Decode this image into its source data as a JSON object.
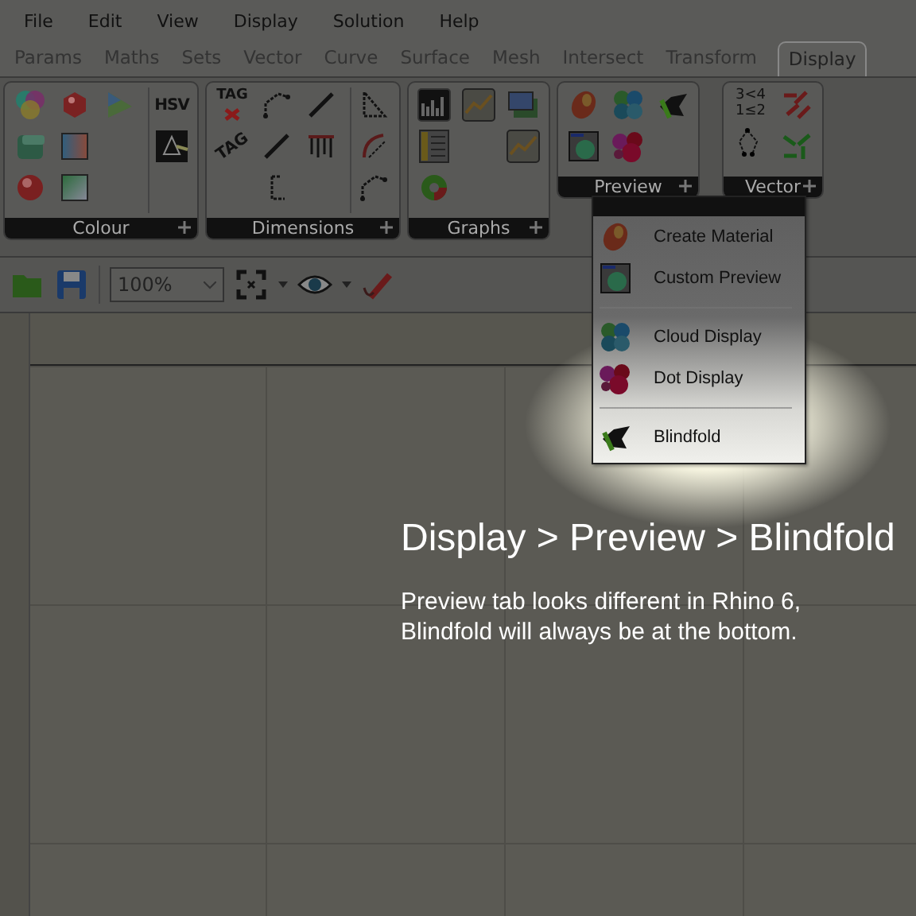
{
  "menu": [
    "File",
    "Edit",
    "View",
    "Display",
    "Solution",
    "Help"
  ],
  "tabs": [
    {
      "label": "Params",
      "selected": false
    },
    {
      "label": "Maths",
      "selected": false
    },
    {
      "label": "Sets",
      "selected": false
    },
    {
      "label": "Vector",
      "selected": false
    },
    {
      "label": "Curve",
      "selected": false
    },
    {
      "label": "Surface",
      "selected": false
    },
    {
      "label": "Mesh",
      "selected": false
    },
    {
      "label": "Intersect",
      "selected": false
    },
    {
      "label": "Transform",
      "selected": false
    },
    {
      "label": "Display",
      "selected": true
    }
  ],
  "ribbon": [
    {
      "name": "Colour",
      "columns": [
        [
          {
            "kind": "color-wheel"
          },
          {
            "kind": "cube"
          },
          {
            "kind": "sphere"
          }
        ],
        [
          {
            "kind": "gem"
          },
          {
            "kind": "gradient-square"
          },
          {
            "kind": "diagonal-gradient-square"
          }
        ],
        [
          {
            "kind": "color-triangle"
          }
        ],
        [
          {
            "kind": "text",
            "label": "HSV"
          },
          {
            "kind": "prism"
          }
        ]
      ]
    },
    {
      "name": "Dimensions",
      "columns": [
        [
          {
            "kind": "tag-delete",
            "label": "TAG"
          },
          {
            "kind": "tag",
            "label": "TAG"
          }
        ],
        [
          {
            "kind": "angle-dimension"
          },
          {
            "kind": "line-dimension"
          },
          {
            "kind": "elevation-dimension"
          }
        ],
        [
          {
            "kind": "line-dimension"
          },
          {
            "kind": "ticks"
          }
        ],
        [
          {
            "kind": "triangle-dimension"
          },
          {
            "kind": "arc-dimension"
          },
          {
            "kind": "angle-dimension"
          }
        ]
      ]
    },
    {
      "name": "Graphs",
      "columns": [
        [
          {
            "kind": "histogram"
          },
          {
            "kind": "legend"
          },
          {
            "kind": "pie-gauge"
          }
        ],
        [
          {
            "kind": "line-graph"
          }
        ],
        [
          {
            "kind": "image"
          },
          {
            "kind": "line-graph"
          }
        ]
      ]
    },
    {
      "name": "Preview",
      "columns": [
        [
          {
            "kind": "egg"
          },
          {
            "kind": "custom-preview"
          }
        ],
        [
          {
            "kind": "cloud"
          },
          {
            "kind": "dots"
          }
        ],
        [
          {
            "kind": "blindfold"
          }
        ]
      ]
    },
    {
      "name": "Vector",
      "columns": [
        [
          {
            "kind": "numbers",
            "label": "3<4 1≤2"
          },
          {
            "kind": "tree"
          }
        ],
        [
          {
            "kind": "arrows"
          },
          {
            "kind": "converging-arrows"
          }
        ]
      ]
    }
  ],
  "toolbar": {
    "zoom": "100%"
  },
  "dropdown": {
    "items": [
      {
        "kind": "egg",
        "label": "Create Material"
      },
      {
        "kind": "custom-preview",
        "label": "Custom Preview"
      },
      {
        "kind": "separator"
      },
      {
        "kind": "cloud",
        "label": "Cloud Display"
      },
      {
        "kind": "dots",
        "label": "Dot Display"
      },
      {
        "kind": "separator"
      },
      {
        "kind": "blindfold",
        "label": "Blindfold"
      }
    ]
  },
  "caption": {
    "title": "Display > Preview > Blindfold",
    "text": "Preview tab looks different in Rhino 6, Blindfold will always be at the bottom."
  }
}
